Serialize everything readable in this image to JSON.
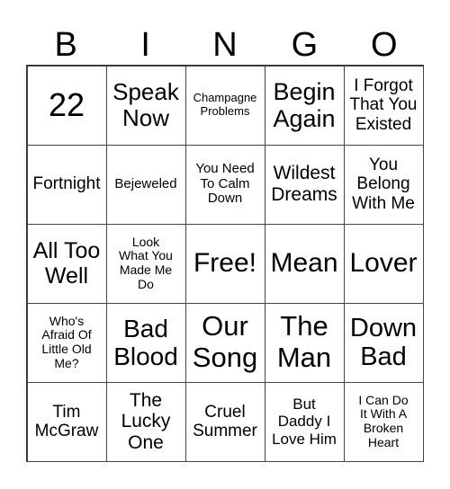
{
  "header": [
    "B",
    "I",
    "N",
    "G",
    "O"
  ],
  "cells": [
    "22",
    "Speak\nNow",
    "Champagne\nProblems",
    "Begin\nAgain",
    "I Forgot\nThat You\nExisted",
    "Fortnight",
    "Bejeweled",
    "You Need\nTo Calm\nDown",
    "Wildest\nDreams",
    "You\nBelong\nWith Me",
    "All Too\nWell",
    "Look\nWhat You\nMade Me\nDo",
    "Free!",
    "Mean",
    "Lover",
    "Who's\nAfraid Of\nLittle Old\nMe?",
    "Bad\nBlood",
    "Our\nSong",
    "The\nMan",
    "Down\nBad",
    "Tim\nMcGraw",
    "The\nLucky\nOne",
    "Cruel\nSummer",
    "But\nDaddy I\nLove Him",
    "I Can Do\nIt With A\nBroken\nHeart"
  ]
}
